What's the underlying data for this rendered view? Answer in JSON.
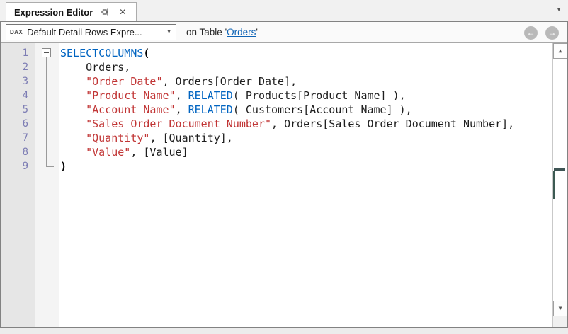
{
  "tab": {
    "title": "Expression Editor"
  },
  "icons": {
    "pin": "pin-icon",
    "close": "✕",
    "tab_overflow": "▼",
    "dropdown_arrow": "▼",
    "back": "←",
    "forward": "→",
    "scroll_up": "▲",
    "scroll_down": "▼"
  },
  "toolbar": {
    "language_badge": "DAX",
    "expression_dropdown_value": "Default Detail Rows Expre...",
    "context_prefix": "on Table",
    "quote_open": "'",
    "table_link": "Orders",
    "quote_close": "'"
  },
  "editor": {
    "lines": [
      {
        "num": "1",
        "tokens": [
          {
            "type": "keyword",
            "text": "SELECTCOLUMNS"
          },
          {
            "type": "paren",
            "text": "("
          }
        ]
      },
      {
        "num": "2",
        "tokens": [
          {
            "type": "plain",
            "text": "    Orders,"
          }
        ]
      },
      {
        "num": "3",
        "tokens": [
          {
            "type": "plain",
            "text": "    "
          },
          {
            "type": "string",
            "text": "\"Order Date\""
          },
          {
            "type": "plain",
            "text": ", Orders[Order Date],"
          }
        ]
      },
      {
        "num": "4",
        "tokens": [
          {
            "type": "plain",
            "text": "    "
          },
          {
            "type": "string",
            "text": "\"Product Name\""
          },
          {
            "type": "plain",
            "text": ", "
          },
          {
            "type": "keyword",
            "text": "RELATED"
          },
          {
            "type": "plain",
            "text": "( Products[Product Name] ),"
          }
        ]
      },
      {
        "num": "5",
        "tokens": [
          {
            "type": "plain",
            "text": "    "
          },
          {
            "type": "string",
            "text": "\"Account Name\""
          },
          {
            "type": "plain",
            "text": ", "
          },
          {
            "type": "keyword",
            "text": "RELATED"
          },
          {
            "type": "plain",
            "text": "( Customers[Account Name] ),"
          }
        ]
      },
      {
        "num": "6",
        "tokens": [
          {
            "type": "plain",
            "text": "    "
          },
          {
            "type": "string",
            "text": "\"Sales Order Document Number\""
          },
          {
            "type": "plain",
            "text": ", Orders[Sales Order Document Number],"
          }
        ]
      },
      {
        "num": "7",
        "tokens": [
          {
            "type": "plain",
            "text": "    "
          },
          {
            "type": "string",
            "text": "\"Quantity\""
          },
          {
            "type": "plain",
            "text": ", [Quantity],"
          }
        ]
      },
      {
        "num": "8",
        "tokens": [
          {
            "type": "plain",
            "text": "    "
          },
          {
            "type": "string",
            "text": "\"Value\""
          },
          {
            "type": "plain",
            "text": ", [Value]"
          }
        ]
      },
      {
        "num": "9",
        "tokens": [
          {
            "type": "paren",
            "text": ")"
          }
        ]
      }
    ]
  },
  "colors": {
    "keyword": "#0064c1",
    "string": "#c13535",
    "text": "#1e1e1e",
    "line_number": "#7d7db4",
    "link": "#0e63b5",
    "scroll_marker": "#3e5454"
  }
}
